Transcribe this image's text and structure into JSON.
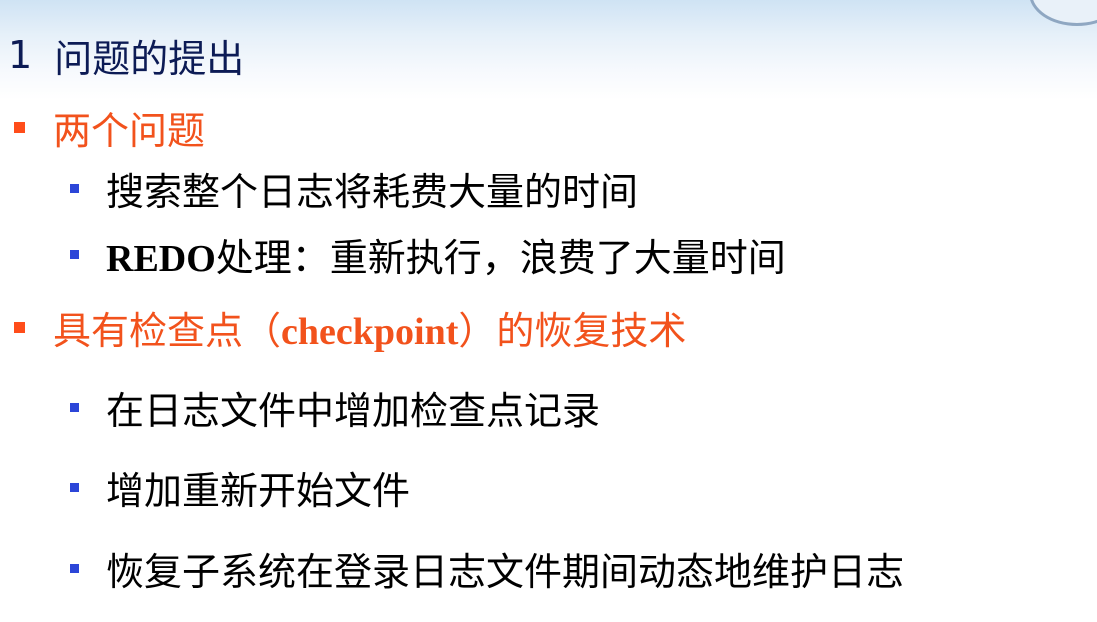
{
  "title": {
    "number": "1",
    "text": "问题的提出"
  },
  "sections": [
    {
      "heading": "两个问题",
      "items": [
        {
          "text": "搜索整个日志将耗费大量的时间"
        },
        {
          "bold_prefix": "REDO",
          "text": "处理：重新执行，浪费了大量时间"
        }
      ]
    },
    {
      "heading_pre": "具有检查点（",
      "heading_latin": "checkpoint",
      "heading_post": "）的恢复技术",
      "items": [
        {
          "text": "在日志文件中增加检查点记录"
        },
        {
          "text": "增加重新开始文件"
        },
        {
          "text": "恢复子系统在登录日志文件期间动态地维护日志"
        }
      ]
    }
  ],
  "colors": {
    "title": "#0c1b55",
    "level1_text": "#f2521c",
    "level1_bullet": "#ff4d1a",
    "level2_bullet": "#2c46d8",
    "level2_text": "#000000"
  }
}
